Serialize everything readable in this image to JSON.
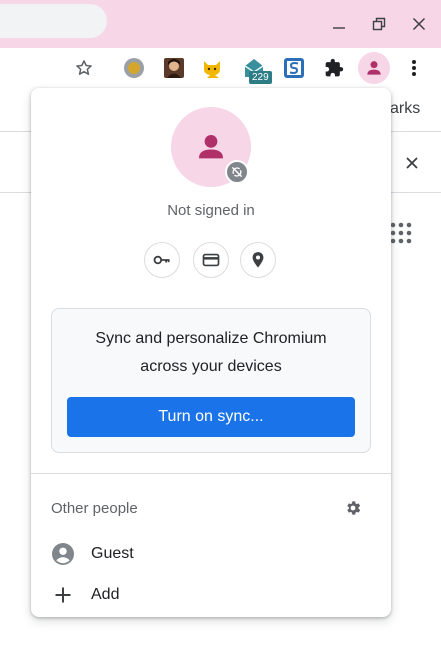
{
  "window": {
    "minimize_icon": "minimize-icon",
    "maximize_icon": "restore-icon",
    "close_icon": "close-icon"
  },
  "toolbar": {
    "bookmark_star_icon": "star-outline-icon",
    "extensions": [
      {
        "name": "circle-extension-icon"
      },
      {
        "name": "avatar-extension-icon"
      },
      {
        "name": "cat-extension-icon"
      },
      {
        "name": "mail-extension-icon",
        "badge": "229"
      },
      {
        "name": "s-extension-icon"
      },
      {
        "name": "puzzle-extensions-icon"
      }
    ],
    "profile_icon": "person-icon",
    "menu_icon": "more-vert-icon"
  },
  "background_page": {
    "bookmarks_partial": "arks",
    "infobar_close_icon": "close-icon",
    "apps_icon": "apps-grid-icon"
  },
  "popup": {
    "status": "Not signed in",
    "quick_actions": [
      {
        "name": "passwords-key-icon"
      },
      {
        "name": "payment-card-icon"
      },
      {
        "name": "addresses-location-icon"
      }
    ],
    "sync_card": {
      "line1": "Sync and personalize Chromium",
      "line2": "across your devices",
      "button": "Turn on sync..."
    },
    "other_people": {
      "title": "Other people",
      "rows": [
        {
          "label": "Guest",
          "icon": "guest-account-icon"
        },
        {
          "label": "Add",
          "icon": "plus-icon"
        }
      ]
    }
  },
  "colors": {
    "titlebar": "#f6d6e7",
    "avatar_fg": "#b0306a",
    "sync_button": "#1a73e8"
  }
}
